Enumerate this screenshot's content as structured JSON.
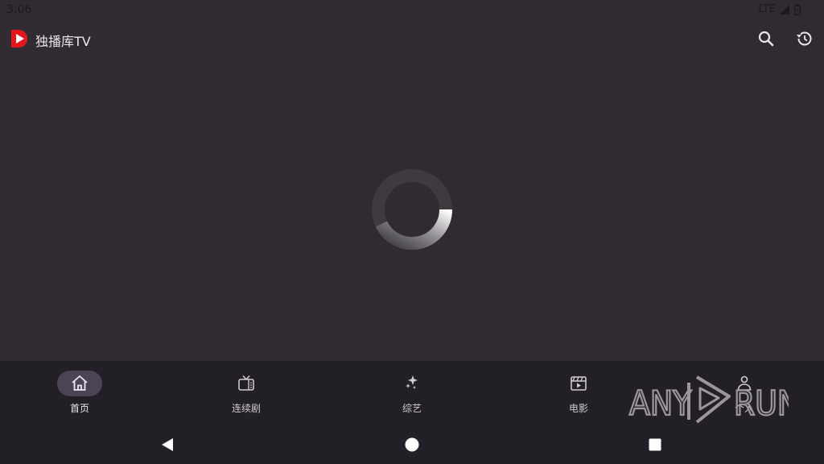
{
  "status_bar": {
    "time": "3:06",
    "network": "LTE"
  },
  "app_bar": {
    "title": "独播库TV",
    "logo_icon": "play-logo-icon",
    "actions": [
      {
        "icon": "search-icon"
      },
      {
        "icon": "history-icon"
      }
    ]
  },
  "main": {
    "loading_indicator": "spinner"
  },
  "bottom_nav": {
    "items": [
      {
        "label": "首页",
        "icon": "home-icon",
        "active": true
      },
      {
        "label": "连续剧",
        "icon": "tv-icon",
        "active": false
      },
      {
        "label": "综艺",
        "icon": "sparkle-icon",
        "active": false
      },
      {
        "label": "电影",
        "icon": "movie-clapper-icon",
        "active": false
      },
      {
        "label": "个人",
        "icon": "person-icon",
        "active": false
      }
    ]
  },
  "system_nav": {
    "buttons": [
      {
        "icon": "back-triangle-icon"
      },
      {
        "icon": "home-circle-icon"
      },
      {
        "icon": "recents-square-icon"
      }
    ]
  },
  "watermark": {
    "text_left": "ANY",
    "text_right": "RUN"
  },
  "colors": {
    "background": "#302b30",
    "nav_background": "#221f26",
    "active_pill": "#4b4454",
    "logo_red": "#e4161b",
    "icon_light": "#e9e5ea"
  }
}
